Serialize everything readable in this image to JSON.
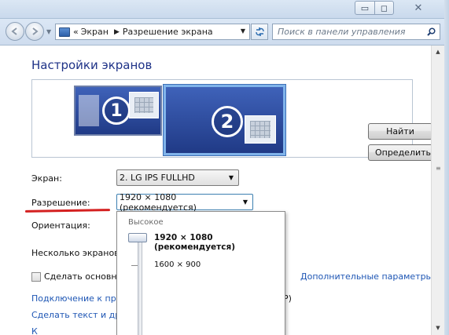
{
  "window": {
    "min_glyph": "▭",
    "max_glyph": "◻",
    "close_glyph": "✕"
  },
  "toolbar": {
    "breadcrumb_prefix": "«",
    "breadcrumb": [
      "Экран",
      "Разрешение экрана"
    ],
    "breadcrumb_separator": "▶",
    "search_placeholder": "Поиск в панели управления"
  },
  "main": {
    "title": "Настройки экранов",
    "monitors": [
      {
        "number": "1"
      },
      {
        "number": "2"
      }
    ],
    "buttons": {
      "find": "Найти",
      "identify": "Определить"
    },
    "fields": {
      "screen_label": "Экран:",
      "screen_value": "2. LG IPS FULLHD",
      "resolution_label": "Разрешение:",
      "resolution_value": "1920 × 1080 (рекомендуется)",
      "orientation_label": "Ориентация:",
      "multi_label": "Несколько экранов:"
    },
    "checkbox_label": "Сделать основным",
    "links": {
      "advanced": "Дополнительные параметры",
      "projector": "Подключение к проек",
      "text_size": "Сделать текст и другие",
      "more": "К"
    },
    "tail_text": "ь P)"
  },
  "resolution_dropdown": {
    "high_label": "Высокое",
    "options": [
      {
        "label": "1920 × 1080 (рекомендуется)",
        "selected": true
      },
      {
        "label": "1600 × 900",
        "selected": false
      }
    ]
  },
  "colors": {
    "title_blue": "#1e3287",
    "link_blue": "#1e56b4",
    "underline_red": "#d42020",
    "monitor_blue": "#2f4fa3"
  }
}
